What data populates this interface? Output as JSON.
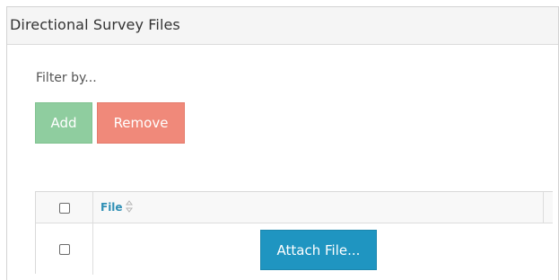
{
  "panel": {
    "title": "Directional Survey Files"
  },
  "filter": {
    "label": "Filter by..."
  },
  "toolbar": {
    "add_label": "Add",
    "remove_label": "Remove"
  },
  "grid": {
    "columns": [
      {
        "key": "select",
        "label": ""
      },
      {
        "key": "file",
        "label": "File",
        "sortable": true,
        "sort_icon": "sort-both-icon"
      }
    ],
    "rows": [
      {
        "selected": false,
        "file_action_label": "Attach File..."
      }
    ],
    "header_checkbox_checked": false
  },
  "colors": {
    "add_button": "#8fcd9f",
    "remove_button": "#f0897a",
    "attach_button": "#1f95c1",
    "column_header_text": "#2f8fb5",
    "header_background": "#f5f5f5"
  }
}
